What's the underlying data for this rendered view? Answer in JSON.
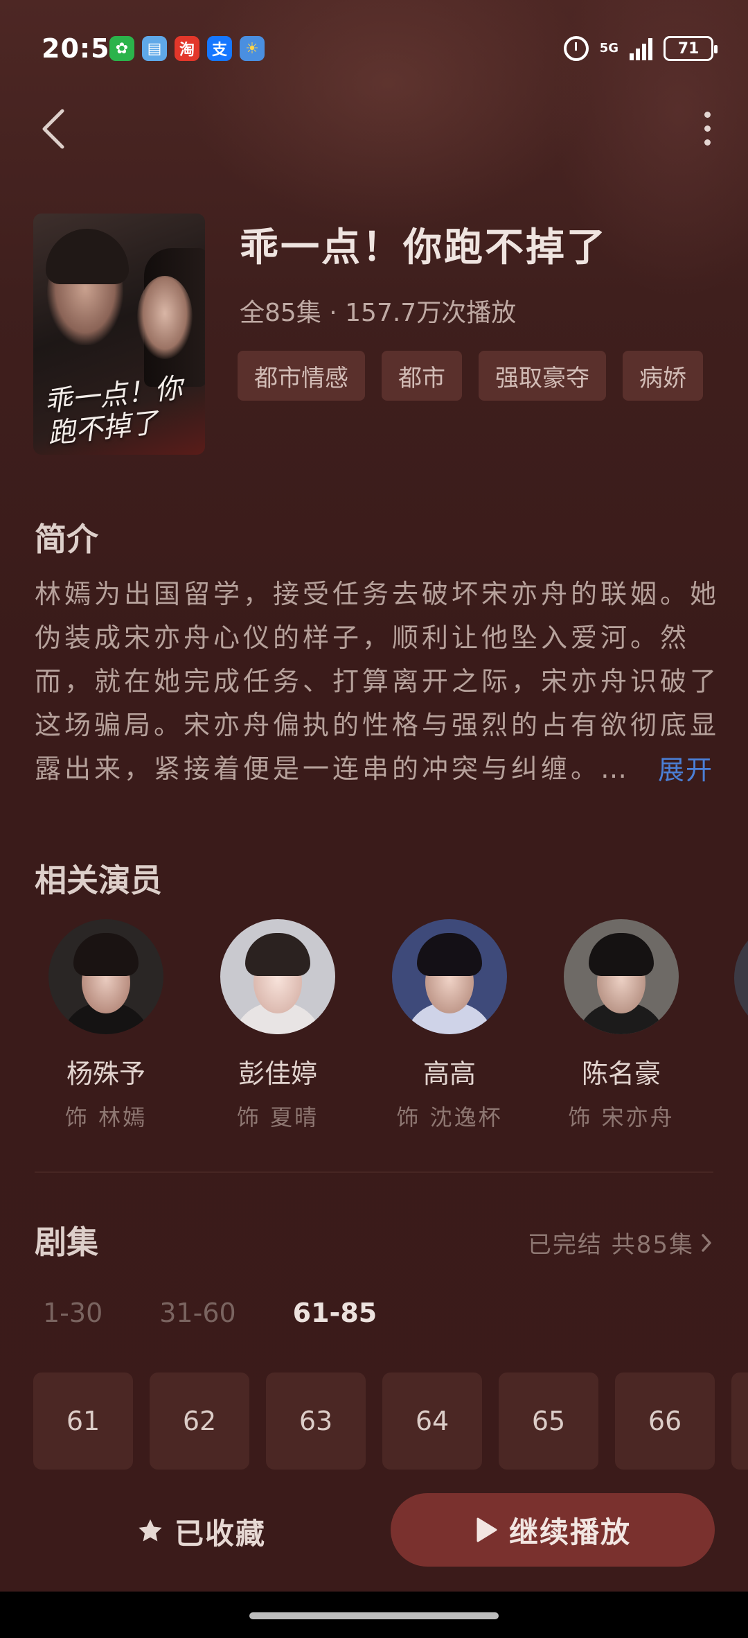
{
  "status_bar": {
    "time": "20:57",
    "network": "5G",
    "battery": "71",
    "apps": [
      {
        "icon": "wechat-icon",
        "glyph": "✿",
        "color": "#2bb34b"
      },
      {
        "icon": "reader-icon",
        "glyph": "▤",
        "color": "#5fa8e8"
      },
      {
        "icon": "taobao-icon",
        "glyph": "淘",
        "color": "#e3372a"
      },
      {
        "icon": "alipay-icon",
        "glyph": "支",
        "color": "#1677ff"
      },
      {
        "icon": "weather-icon",
        "glyph": "☀",
        "color": "#4a8fe0"
      }
    ]
  },
  "drama": {
    "title": "乖一点！你跑不掉了",
    "meta": "全85集 · 157.7万次播放",
    "poster_title": "乖一点！你跑不掉了",
    "tags": [
      "都市情感",
      "都市",
      "强取豪夺",
      "病娇"
    ]
  },
  "synopsis": {
    "heading": "简介",
    "text": "林嫣为出国留学，接受任务去破坏宋亦舟的联姻。她伪装成宋亦舟心仪的样子，顺利让他坠入爱河。然而，就在她完成任务、打算离开之际，宋亦舟识破了这场骗局。宋亦舟偏执的性格与强烈的占有欲彻底显露出来，紧接着便是一连串的冲突与纠缠。…",
    "expand_label": "展开"
  },
  "cast": {
    "heading": "相关演员",
    "members": [
      {
        "name": "杨殊予",
        "role": "饰 林嫣"
      },
      {
        "name": "彭佳婷",
        "role": "饰 夏晴"
      },
      {
        "name": "高高",
        "role": "饰 沈逸杯"
      },
      {
        "name": "陈名豪",
        "role": "饰 宋亦舟"
      }
    ]
  },
  "episodes": {
    "heading": "剧集",
    "status": "已完结 共85集",
    "ranges": [
      "1-30",
      "31-60",
      "61-85"
    ],
    "active_range": "61-85",
    "items": [
      "61",
      "62",
      "63",
      "64",
      "65",
      "66"
    ]
  },
  "actions": {
    "favorite_label": "已收藏",
    "play_label": "继续播放"
  },
  "colors": {
    "background": "#3b1b1a",
    "accent_link": "#4b7fd6",
    "play_button": "#7a312e"
  }
}
